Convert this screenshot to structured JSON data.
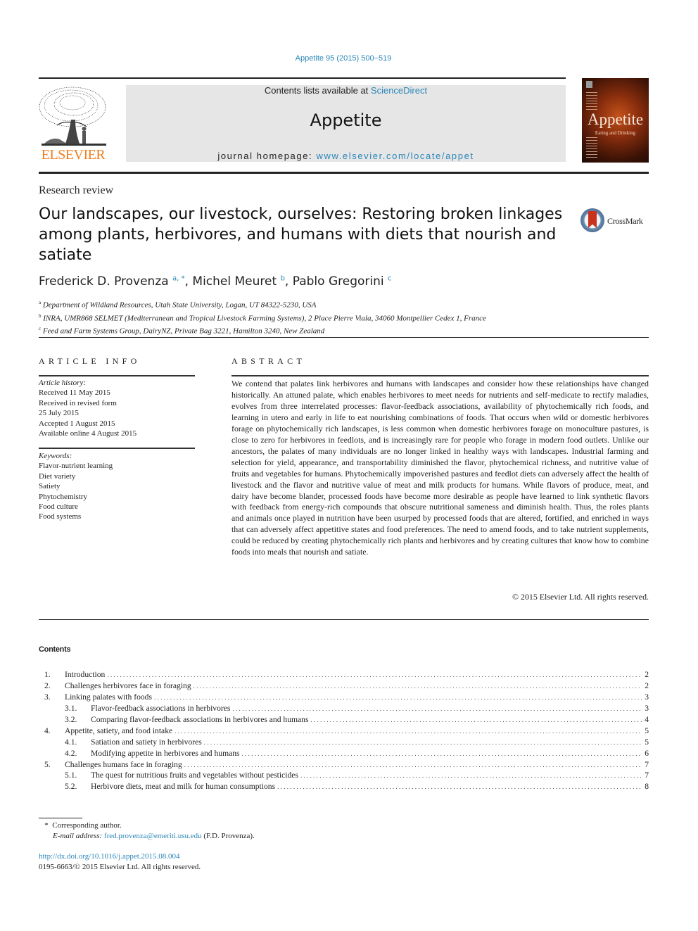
{
  "header": {
    "journal_ref": "Appetite 95 (2015) 500−519",
    "contents_prefix": "Contents lists available at ",
    "contents_link": "ScienceDirect",
    "journal_title": "Appetite",
    "homepage_prefix": "journal homepage: ",
    "homepage_link": "www.elsevier.com/locate/appet",
    "publisher_logo_text": "ELSEVIER",
    "cover_title": "Appetite",
    "cover_subtitle": "Eating and Drinking"
  },
  "article": {
    "type": "Research review",
    "title": "Our landscapes, our livestock, ourselves: Restoring broken linkages among plants, herbivores, and humans with diets that nourish and satiate",
    "crossmark_label": "CrossMark",
    "authors": [
      {
        "name": "Frederick D. Provenza",
        "sup": "a, *"
      },
      {
        "name": "Michel Meuret",
        "sup": "b"
      },
      {
        "name": "Pablo Gregorini",
        "sup": "c"
      }
    ],
    "affiliations": [
      {
        "key": "a",
        "text": "Department of Wildland Resources, Utah State University, Logan, UT 84322-5230, USA"
      },
      {
        "key": "b",
        "text": "INRA, UMR868 SELMET (Mediterranean and Tropical Livestock Farming Systems), 2 Place Pierre Viala, 34060 Montpellier Cedex 1, France"
      },
      {
        "key": "c",
        "text": "Feed and Farm Systems Group, DairyNZ, Private Bag 3221, Hamilton 3240, New Zealand"
      }
    ]
  },
  "article_info": {
    "heading": "ARTICLE INFO",
    "history_label": "Article history:",
    "history": [
      "Received 11 May 2015",
      "Received in revised form",
      "25 July 2015",
      "Accepted 1 August 2015",
      "Available online 4 August 2015"
    ],
    "keywords_label": "Keywords:",
    "keywords": [
      "Flavor-nutrient learning",
      "Diet variety",
      "Satiety",
      "Phytochemistry",
      "Food culture",
      "Food systems"
    ]
  },
  "abstract": {
    "heading": "ABSTRACT",
    "text": "We contend that palates link herbivores and humans with landscapes and consider how these relationships have changed historically. An attuned palate, which enables herbivores to meet needs for nutrients and self-medicate to rectify maladies, evolves from three interrelated processes: flavor-feedback associations, availability of phytochemically rich foods, and learning in utero and early in life to eat nourishing combinations of foods. That occurs when wild or domestic herbivores forage on phytochemically rich landscapes, is less common when domestic herbivores forage on monoculture pastures, is close to zero for herbivores in feedlots, and is increasingly rare for people who forage in modern food outlets. Unlike our ancestors, the palates of many individuals are no longer linked in healthy ways with landscapes. Industrial farming and selection for yield, appearance, and transportability diminished the flavor, phytochemical richness, and nutritive value of fruits and vegetables for humans. Phytochemically impoverished pastures and feedlot diets can adversely affect the health of livestock and the flavor and nutritive value of meat and milk products for humans. While flavors of produce, meat, and dairy have become blander, processed foods have become more desirable as people have learned to link synthetic flavors with feedback from energy-rich compounds that obscure nutritional sameness and diminish health. Thus, the roles plants and animals once played in nutrition have been usurped by processed foods that are altered, fortified, and enriched in ways that can adversely affect appetitive states and food preferences. The need to amend foods, and to take nutrient supplements, could be reduced by creating phytochemically rich plants and herbivores and by creating cultures that know how to combine foods into meals that nourish and satiate.",
    "copyright": "© 2015 Elsevier Ltd. All rights reserved."
  },
  "contents": {
    "heading": "Contents",
    "items": [
      {
        "num": "1.",
        "title": "Introduction",
        "page": "2",
        "level": 1
      },
      {
        "num": "2.",
        "title": "Challenges herbivores face in foraging",
        "page": "2",
        "level": 1
      },
      {
        "num": "3.",
        "title": "Linking palates with foods",
        "page": "3",
        "level": 1
      },
      {
        "num": "3.1.",
        "title": "Flavor-feedback associations in herbivores",
        "page": "3",
        "level": 2
      },
      {
        "num": "3.2.",
        "title": "Comparing flavor-feedback associations in herbivores and humans",
        "page": "4",
        "level": 2
      },
      {
        "num": "4.",
        "title": "Appetite, satiety, and food intake",
        "page": "5",
        "level": 1
      },
      {
        "num": "4.1.",
        "title": "Satiation and satiety in herbivores",
        "page": "5",
        "level": 2
      },
      {
        "num": "4.2.",
        "title": "Modifying appetite in herbivores and humans",
        "page": "6",
        "level": 2
      },
      {
        "num": "5.",
        "title": "Challenges humans face in foraging",
        "page": "7",
        "level": 1
      },
      {
        "num": "5.1.",
        "title": "The quest for nutritious fruits and vegetables without pesticides",
        "page": "7",
        "level": 2
      },
      {
        "num": "5.2.",
        "title": "Herbivore diets, meat and milk for human consumptions",
        "page": "8",
        "level": 2
      }
    ]
  },
  "footnotes": {
    "corresponding_marker": "*",
    "corresponding_text": "Corresponding author.",
    "email_label": "E-mail address:",
    "email": "fred.provenza@emeriti.usu.edu",
    "email_suffix": " (F.D. Provenza).",
    "doi": "http://dx.doi.org/10.1016/j.appet.2015.08.004",
    "issn_copyright": "0195-6663/© 2015 Elsevier Ltd. All rights reserved."
  }
}
